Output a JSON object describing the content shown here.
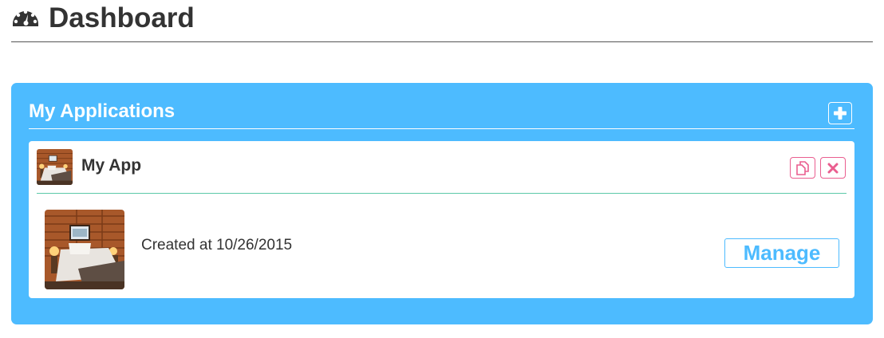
{
  "header": {
    "title": "Dashboard",
    "icon": "dashboard-gauge-icon"
  },
  "panel": {
    "title": "My Applications",
    "add_icon": "plus-icon",
    "color": "#4dbbff"
  },
  "apps": [
    {
      "name": "My App",
      "created_text": "Created at 10/26/2015",
      "manage_label": "Manage",
      "thumbnail": "bedroom-photo",
      "actions": [
        {
          "icon": "copy-icon",
          "color": "#ea5e8f"
        },
        {
          "icon": "close-icon",
          "color": "#ea5e8f"
        }
      ]
    }
  ]
}
